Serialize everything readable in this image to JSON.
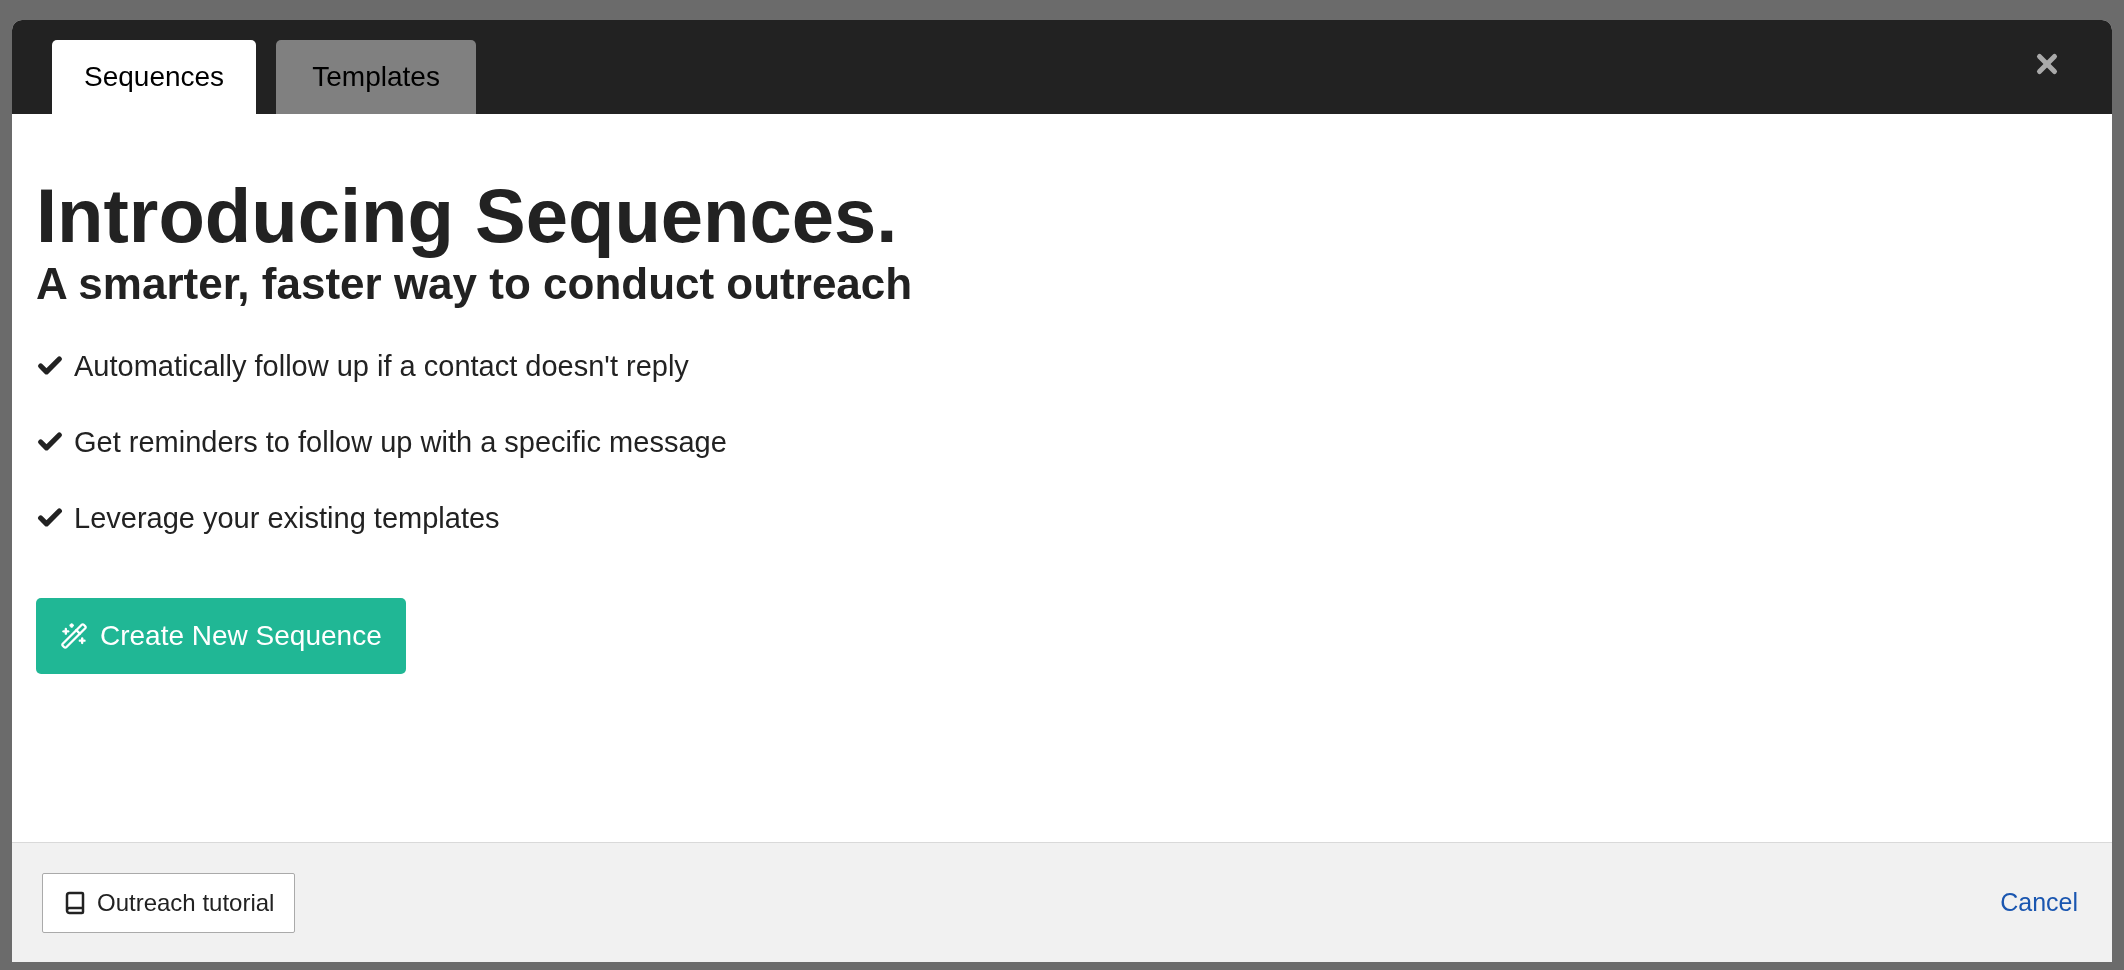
{
  "tabs": [
    {
      "label": "Sequences",
      "selected": true
    },
    {
      "label": "Templates",
      "selected": false
    }
  ],
  "heading": "Introducing Sequences.",
  "subheading": "A smarter, faster way to conduct outreach",
  "features": [
    "Automatically follow up if a contact doesn't reply",
    "Get reminders to follow up with a specific message",
    "Leverage your existing templates"
  ],
  "primary_button": "Create New Sequence",
  "footer": {
    "tutorial_button": "Outreach tutorial",
    "cancel_link": "Cancel"
  }
}
